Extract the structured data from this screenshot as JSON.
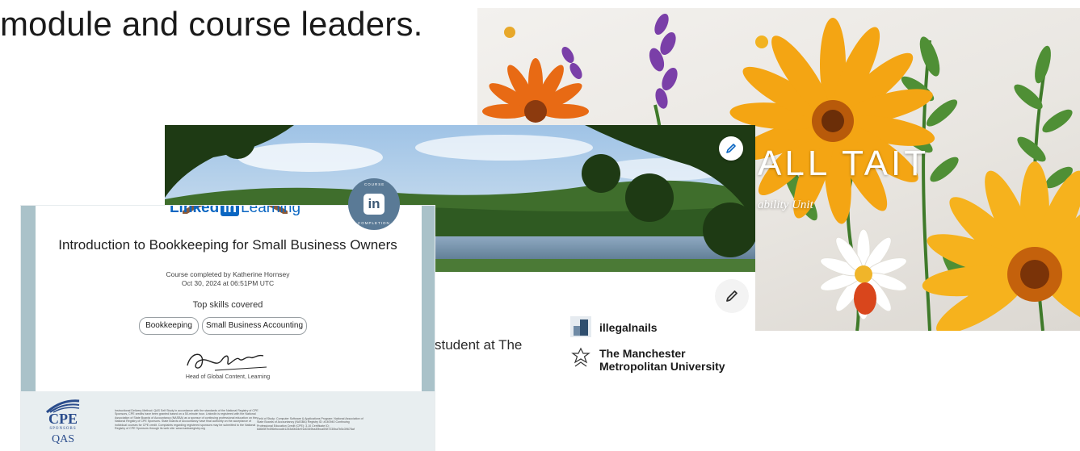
{
  "heading": "module and course leaders.",
  "floral_card": {
    "title": "ALL TAIT",
    "subtitle": "ability Unit"
  },
  "profile_card": {
    "headline_fragment": "student at The",
    "entities": [
      {
        "name": "illegalnails",
        "icon": "company-logo-icon"
      },
      {
        "name_line1": "The Manchester",
        "name_line2": "Metropolitan University",
        "icon": "university-logo-icon"
      }
    ],
    "edit_icon": "pencil-icon"
  },
  "certificate": {
    "logo_word": "Linked",
    "logo_box": "in",
    "logo_suffix": "Learning",
    "title": "Introduction to Bookkeeping for Small Business Owners",
    "completed_by": "Course completed by Katherine Hornsey",
    "date": "Oct 30, 2024 at 06:51PM UTC",
    "skills_heading": "Top skills covered",
    "skills": [
      "Bookkeeping",
      "Small Business Accounting"
    ],
    "signer_role": "Head of Global Content, Learning",
    "badge_top": "COURSE",
    "badge_bottom": "COMPLETION",
    "badge_logo": "in",
    "cpe_text": "CPE",
    "cpe_sub": "SPONSORS",
    "qas_text": "QAS",
    "fine_print_left": "Instructional Delivery Method: QAS Self Study In accordance with the standards of the National Registry of CPE Sponsors, CPE credits have been granted based on a 50-minute hour. LinkedIn is registered with the National Association of State Boards of Accountancy (NASBA) as a sponsor of continuing professional education on the National Registry of CPE Sponsors. State boards of accountancy have final authority on the acceptance of individual courses for CPE credit. Complaints regarding registered sponsors may be submitted to the National Registry of CPE Sponsors through its web site: www.nasbaregistry.org",
    "fine_print_right": "Field of Study: Computer Software & Applications Program: National Association of State Boards of Accountancy (NASBA) Registry ID: #140940 Continuing Professional Education Credit (CPE): 3.10 Certificate ID: 6d6b5f7b496ebcccdb1253d0bd4e91d0349ba49bca0f4f7230ba7b5c39678af"
  }
}
